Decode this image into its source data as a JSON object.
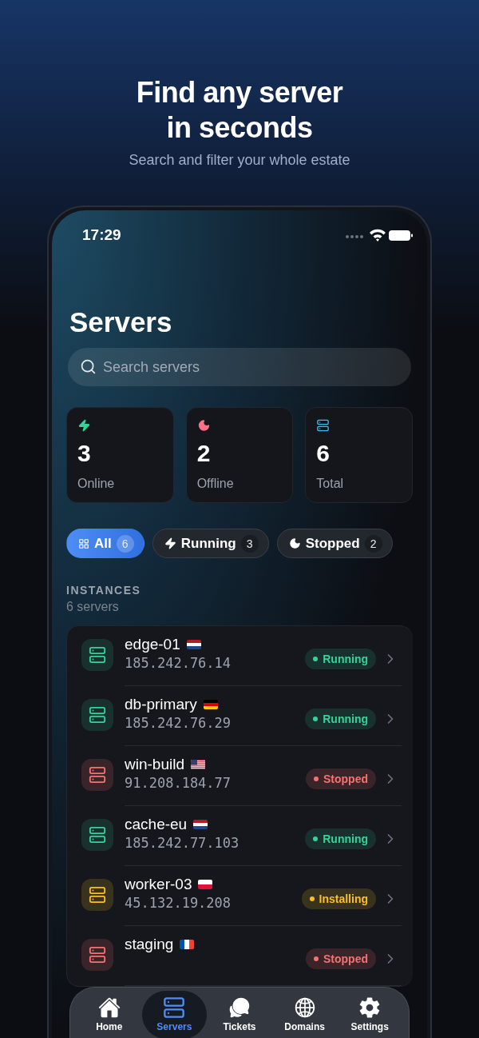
{
  "hero": {
    "title_lines": [
      "Find any server",
      "in seconds"
    ],
    "subtitle": "Search and filter your whole estate"
  },
  "status_bar": {
    "time": "17:29"
  },
  "screen": {
    "title": "Servers",
    "search": {
      "placeholder": "Search servers"
    }
  },
  "stats": [
    {
      "kind": "online",
      "value": "3",
      "label": "Online"
    },
    {
      "kind": "offline",
      "value": "2",
      "label": "Offline"
    },
    {
      "kind": "total",
      "value": "6",
      "label": "Total"
    }
  ],
  "filters": [
    {
      "kind": "all",
      "label": "All",
      "count": "6",
      "selected": true
    },
    {
      "kind": "running",
      "label": "Running",
      "count": "3",
      "selected": false
    },
    {
      "kind": "stopped",
      "label": "Stopped",
      "count": "2",
      "selected": false
    }
  ],
  "section": {
    "label": "INSTANCES",
    "count": "6 servers"
  },
  "servers": [
    {
      "name": "edge-01",
      "flag": {
        "kind": "nl"
      },
      "ip": "185.242.76.14",
      "status": {
        "kind": "running",
        "label": "Running"
      }
    },
    {
      "name": "db-primary",
      "flag": {
        "kind": "de"
      },
      "ip": "185.242.76.29",
      "status": {
        "kind": "running",
        "label": "Running"
      }
    },
    {
      "name": "win-build",
      "flag": {
        "kind": "us"
      },
      "ip": "91.208.184.77",
      "status": {
        "kind": "stopped",
        "label": "Stopped"
      }
    },
    {
      "name": "cache-eu",
      "flag": {
        "kind": "nl"
      },
      "ip": "185.242.77.103",
      "status": {
        "kind": "running",
        "label": "Running"
      }
    },
    {
      "name": "worker-03",
      "flag": {
        "kind": "pl"
      },
      "ip": "45.132.19.208",
      "status": {
        "kind": "installing",
        "label": "Installing"
      }
    },
    {
      "name": "staging",
      "flag": {
        "kind": "fr"
      },
      "status": {
        "kind": "stopped",
        "label": "Stopped"
      }
    }
  ],
  "tabs": [
    {
      "kind": "home",
      "label": "Home",
      "selected": false
    },
    {
      "kind": "servers",
      "label": "Servers",
      "selected": true
    },
    {
      "kind": "tickets",
      "label": "Tickets",
      "selected": false
    },
    {
      "kind": "domains",
      "label": "Domains",
      "selected": false
    },
    {
      "kind": "settings",
      "label": "Settings",
      "selected": false
    }
  ]
}
